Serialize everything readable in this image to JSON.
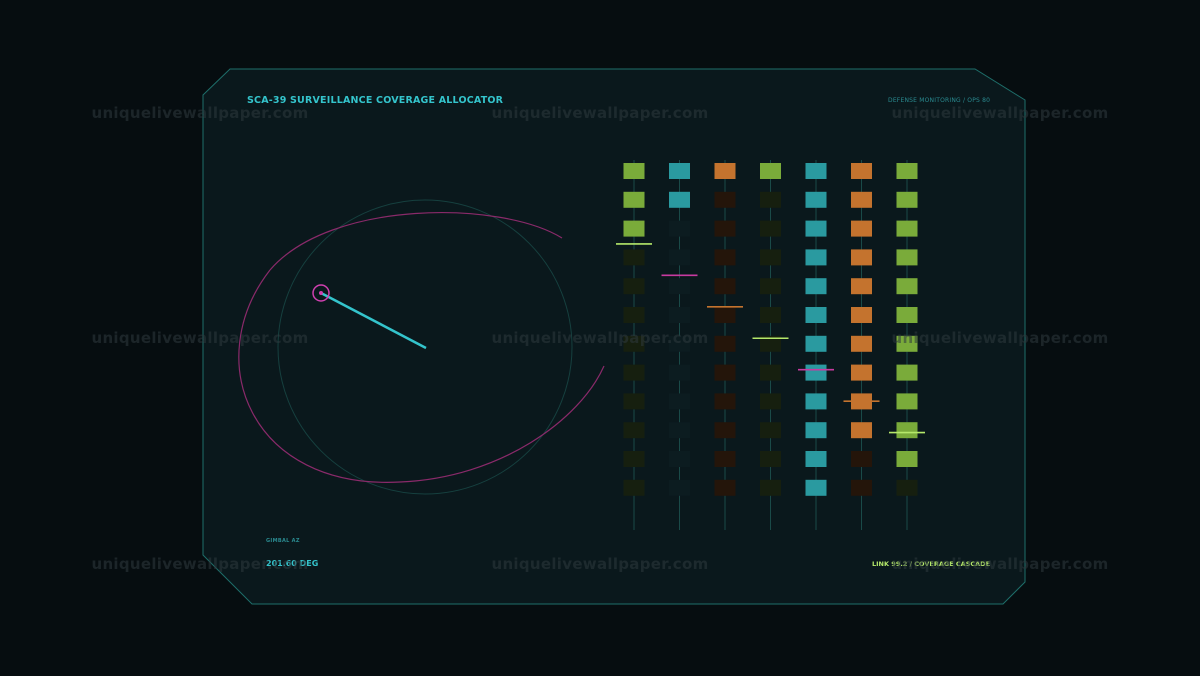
{
  "header": {
    "id": "SCA-39",
    "title": "SURVEILLANCE COVERAGE ALLOCATOR",
    "section": "DEFENSE MONITORING / OPS 80"
  },
  "gimbal": {
    "label": "GIMBAL AZ",
    "value": "201.60 DEG"
  },
  "footer": {
    "status": "LINK 99.2 / COVERAGE CASCADE"
  },
  "watermark": "uniquelivewallpaper.com",
  "colors": {
    "background": "#060d10",
    "panel": "#0a181c",
    "panel_border": "#1e6e6a",
    "cyan": "#2a9aa0",
    "green": "#7aab3a",
    "orange": "#c4732e",
    "magenta": "#c83aa0",
    "lime": "#b5e86a"
  },
  "columns": [
    {
      "color": "green",
      "lit": [
        1,
        1,
        1,
        0,
        0,
        0,
        0,
        0,
        0,
        0,
        0,
        0
      ],
      "marker": 3.3,
      "marker_color": "lime"
    },
    {
      "color": "cyan",
      "lit": [
        1,
        1,
        0,
        0,
        0,
        0,
        0,
        0,
        0,
        0,
        0,
        0
      ],
      "marker": 4.7,
      "marker_color": "magenta"
    },
    {
      "color": "orange",
      "lit": [
        1,
        0,
        0,
        0,
        0,
        0,
        0,
        0,
        0,
        0,
        0,
        0
      ],
      "marker": 6.1,
      "marker_color": "orange"
    },
    {
      "color": "green",
      "lit": [
        1,
        0,
        0,
        0,
        0,
        0,
        0,
        0,
        0,
        0,
        0,
        0
      ],
      "marker": 7.5,
      "marker_color": "lime"
    },
    {
      "color": "cyan",
      "lit": [
        1,
        1,
        1,
        1,
        1,
        1,
        1,
        1,
        1,
        1,
        1,
        1
      ],
      "marker": 8.9,
      "marker_color": "magenta"
    },
    {
      "color": "orange",
      "lit": [
        1,
        1,
        1,
        1,
        1,
        1,
        1,
        1,
        1,
        1,
        0,
        0
      ],
      "marker": 10.3,
      "marker_color": "orange"
    },
    {
      "color": "green",
      "lit": [
        1,
        1,
        1,
        1,
        1,
        1,
        1,
        1,
        1,
        1,
        1,
        0
      ],
      "marker": 11.7,
      "marker_color": "lime"
    }
  ],
  "wm": [
    {
      "text": "uniquelivewallpaper.com"
    },
    {
      "text": "uniquelivewallpaper.com"
    },
    {
      "text": "uniquelivewallpaper.com"
    },
    {
      "text": "uniquelivewallpaper.com"
    },
    {
      "text": "uniquelivewallpaper.com"
    },
    {
      "text": "uniquelivewallpaper.com"
    },
    {
      "text": "uniquelivewallpaper.com"
    },
    {
      "text": "uniquelivewallpaper.com"
    },
    {
      "text": "uniquelivewallpaper.com"
    }
  ]
}
